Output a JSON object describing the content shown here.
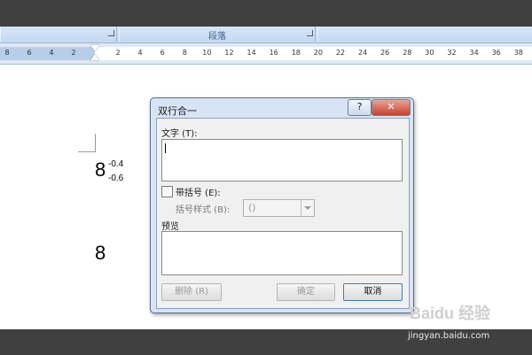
{
  "ribbon": {
    "group_label": "段落"
  },
  "ruler": {
    "ticks": [
      "8",
      "6",
      "4",
      "2",
      "2",
      "4",
      "6",
      "8",
      "10",
      "12",
      "14",
      "16",
      "18",
      "20",
      "22",
      "24",
      "26",
      "28",
      "30",
      "32",
      "34",
      "36",
      "38"
    ]
  },
  "document": {
    "expr1_base": "8",
    "expr1_sup": "-0.4",
    "expr1_sub": "-0.6",
    "expr2_base": "8"
  },
  "dialog": {
    "title": "双行合一",
    "help_label": "?",
    "close_label": "✕",
    "text_label": "文字 (T):",
    "text_value": "",
    "bracket_label": "带括号 (E):",
    "bracket_style_label": "括号样式 (B):",
    "bracket_style_value": "()",
    "preview_label": "预览",
    "delete_label": "删除 (R)",
    "ok_label": "确定",
    "cancel_label": "取消"
  },
  "watermark": {
    "logo": "Baidu 经验",
    "url": "jingyan.baidu.com"
  },
  "colors": {
    "ribbon": "#c4d8f0",
    "dialog_frame": "#d6e4f5",
    "close_button": "#c5412c",
    "chrome": "#404040"
  }
}
